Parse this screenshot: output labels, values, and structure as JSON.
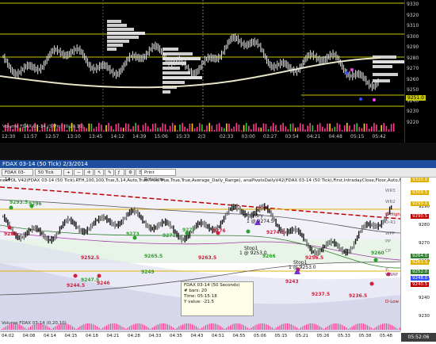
{
  "top_chart": {
    "price_labels": [
      "9330",
      "9320",
      "9310",
      "9300",
      "9290",
      "9280",
      "9270",
      "9260",
      "9250",
      "9240",
      "9230",
      "9220"
    ],
    "current_price": "9251.0",
    "time_labels": [
      "12:30",
      "11:57",
      "12:57",
      "13:10",
      "13:45",
      "14:12",
      "14:39",
      "15:06",
      "15:33",
      "2/3",
      "02:33",
      "03:00",
      "03:27",
      "03:54",
      "04:21",
      "04:48",
      "05:15",
      "05:42"
    ],
    "volume_label": "Volume FDAX 03-14 (3 Min) (0,20,10)"
  },
  "window": {
    "title": "FDAX 03-14  (50 Tick)  2/3/2014"
  },
  "toolbar": {
    "instrument": "FDAX 03-14",
    "period": "50 Tick",
    "print_label": "Print Rotations"
  },
  "indicator_line": "neePOL V42(FDAX 03-14 (50 Tick),RTH,100,100,True,5,14,Auto,True,True,True,True,True,Average_Daily_Range), anaPivotsDailyV42(FDAX 03-14 (50 Tick),First,IntradayClose,Floor,Auto,False,True,0,2,0), anaPivotsWeekly",
  "bottom_chart": {
    "price_labels": [
      "9290",
      "9280",
      "9270",
      "9260",
      "9250",
      "9240",
      "9230"
    ],
    "level_labels": [
      {
        "text": "WR3",
        "color": "#6d6d6d"
      },
      {
        "text": "WR2",
        "color": "#6d6d6d"
      },
      {
        "text": "D-High",
        "color": "#c00000"
      },
      {
        "text": "D-R1",
        "color": "#6d6d6d"
      },
      {
        "text": "WPP",
        "color": "#6d6d6d"
      },
      {
        "text": "PP",
        "color": "#6d6d6d"
      },
      {
        "text": "CP",
        "color": "#6d6d6d"
      },
      {
        "text": "Y-VWAP",
        "color": "#8b3a8b"
      },
      {
        "text": "D-Low",
        "color": "#c00000"
      }
    ],
    "price_tags": [
      "9320.0",
      "9309.5",
      "9299.0",
      "9290.5",
      "9264.0",
      "9263.5",
      "9252.0",
      "9248.0",
      "9240.5"
    ],
    "swing_labels": [
      "9293.5",
      "9296",
      "9282",
      "9273",
      "9276",
      "9277",
      "9271",
      "9274.5",
      "9265.5",
      "9266",
      "9263.5",
      "9256.5",
      "9252.5",
      "9249",
      "9247.5",
      "9244.5",
      "9246",
      "9243",
      "9260",
      "9236.5",
      "9237.5"
    ],
    "markers": [
      "Entry",
      "1 @ 9274.5",
      "Stop1",
      "1 @ 9253.0",
      "Stop1",
      "1 @ 9253.0"
    ],
    "tooltip": {
      "title": "FDAX 03-14 (50 Seconds)",
      "bars": "# bars:  20",
      "time": "Time:  05:15:18",
      "yvalue": "Y value: -21.5"
    },
    "volume_label": "Volume FDAX 03-14 (0,20,10)",
    "time_labels": [
      "04:02",
      "04:08",
      "04:14",
      "04:15",
      "04:18",
      "04:21",
      "04:28",
      "04:33",
      "04:35",
      "04:43",
      "04:51",
      "04:55",
      "05:06",
      "05:15",
      "05:21",
      "05:26",
      "05:33",
      "05:38",
      "05:48"
    ],
    "clock": "05:52:06"
  },
  "colors": {
    "up_bar": "#111111",
    "down_bar": "#555555",
    "top_bg": "#000000",
    "title_bar": "#1d4f9e",
    "volume": "#ff3b8e"
  }
}
